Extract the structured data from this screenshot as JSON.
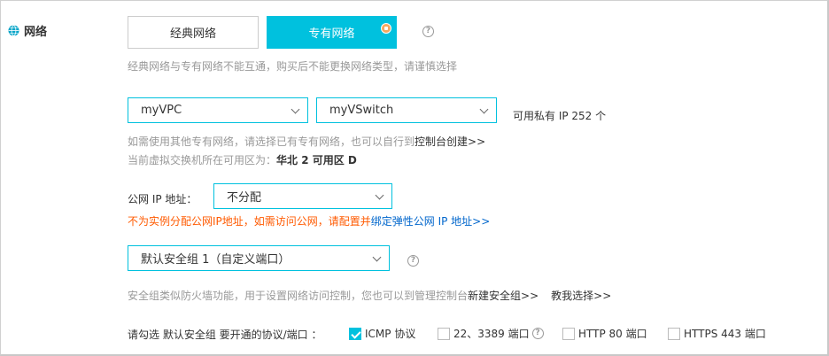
{
  "section": {
    "title": "网络",
    "icon": "globe-icon"
  },
  "network_type": {
    "classic_label": "经典网络",
    "vpc_label": "专有网络",
    "selected": "专有网络",
    "hint": "经典网络与专有网络不能互通，购买后不能更换网络类型，请谨慎选择"
  },
  "vpc": {
    "vpc_select": "myVPC",
    "vswitch_select": "myVSwitch",
    "available_ip": "可用私有 IP 252 个",
    "hint_prefix": "如需使用其他专有网络，请选择已有专有网络，也可以自行到",
    "hint_link": "控制台创建>>",
    "zone_prefix": "当前虚拟交换机所在可用区为：",
    "zone_value": "华北 2 可用区 D"
  },
  "public_ip": {
    "label": "公网 IP 地址：",
    "value": "不分配",
    "warning": "不为实例分配公网IP地址，如需访问公网，请配置并",
    "link": "绑定弹性公网 IP 地址>>"
  },
  "security_group": {
    "value": "默认安全组 1（自定义端口）",
    "hint": "安全组类似防火墙功能，用于设置网络访问控制，您也可以到管理控制台",
    "create_link": "新建安全组>>",
    "teach_link": "教我选择>>"
  },
  "protocols": {
    "label": "请勾选 默认安全组 要开通的协议/端口 ：",
    "items": [
      {
        "label": "ICMP 协议",
        "checked": true
      },
      {
        "label": "22、3389 端口",
        "checked": false
      },
      {
        "label": "HTTP 80 端口",
        "checked": false
      },
      {
        "label": "HTTPS 443 端口",
        "checked": false
      }
    ]
  },
  "colors": {
    "accent": "#00c1de",
    "warning": "#ff5a00",
    "link": "#0066cc",
    "badge": "#f6a85e"
  }
}
